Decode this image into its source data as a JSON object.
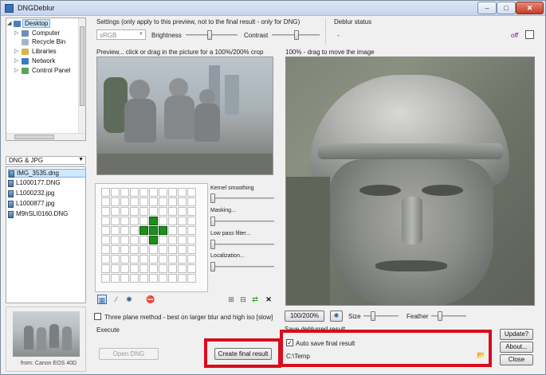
{
  "window": {
    "title": "DNGDeblur"
  },
  "folder_tree": {
    "items": [
      {
        "label": "Desktop",
        "selected": true
      },
      {
        "label": "Computer"
      },
      {
        "label": "Recycle Bin"
      },
      {
        "label": "Libraries"
      },
      {
        "label": "Network"
      },
      {
        "label": "Control Panel"
      }
    ]
  },
  "filter": {
    "value": "DNG & JPG"
  },
  "file_list": {
    "items": [
      {
        "label": "IMG_3535.dng",
        "selected": true
      },
      {
        "label": "L1000177.DNG"
      },
      {
        "label": "L1000232.jpg"
      },
      {
        "label": "L1000877.jpg"
      },
      {
        "label": "M9hSLI0160.DNG"
      }
    ]
  },
  "thumbnail": {
    "caption": "from: Canon EOS 40D"
  },
  "settings": {
    "title": "Settings (only apply to this preview, not to the final result - only for DNG)",
    "colorspace_value": "sRGB",
    "brightness_label": "Brightness",
    "contrast_label": "Contrast",
    "brightness_level": 0.45,
    "contrast_level": 0.5
  },
  "deblur_status": {
    "title": "Deblur status",
    "value": "-",
    "off_label": "off"
  },
  "preview": {
    "caption": "Preview... click or drag in the picture for a 100%/200% crop"
  },
  "crop": {
    "caption": "100% - drag to move the image"
  },
  "kernel": {
    "sliders": [
      {
        "label": "Kernel smoothing",
        "level": 0.0
      },
      {
        "label": "Masking...",
        "level": 0.0
      },
      {
        "label": "Low pass filter...",
        "level": 0.0
      },
      {
        "label": "Localization...",
        "level": 0.0
      }
    ]
  },
  "options": {
    "three_plane_label": "Three plane method - best on larger blur and high iso [slow]"
  },
  "zoom": {
    "button_label": "100/200%",
    "size_label": "Size",
    "feather_label": "Feather",
    "size_level": 0.25,
    "feather_level": 0.2
  },
  "execute": {
    "title": "Execute",
    "open_dng_label": "Open DNG",
    "create_label": "Create final result"
  },
  "save": {
    "title": "Save deblurred result",
    "auto_save_label": "Auto save final result",
    "path": "C:\\Temp"
  },
  "side_buttons": {
    "update_label": "Update?",
    "about_label": "About...",
    "close_label": "Close"
  },
  "colors": {
    "highlight": "#d90d1c",
    "grid_on": "#1e8c1e",
    "status_off": "#8b008b"
  }
}
